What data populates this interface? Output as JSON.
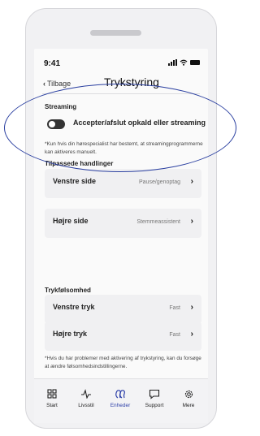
{
  "status": {
    "time": "9:41"
  },
  "nav": {
    "back_label": "Tilbage",
    "title": "Trykstyring"
  },
  "streaming": {
    "heading": "Streaming",
    "toggle_label": "Accepter/afslut opkald eller streaming",
    "toggle_on": false,
    "note": "*Kun hvis din hørespecialist har bestemt, at streamingprogrammerne kan aktiveres manuelt."
  },
  "actions": {
    "heading": "Tilpassede handlinger",
    "items": [
      {
        "label": "Venstre side",
        "value": "Pause/genoptag"
      },
      {
        "label": "Højre side",
        "value": "Stemmeassistent"
      }
    ]
  },
  "sensitivity": {
    "heading": "Trykfølsomhed",
    "items": [
      {
        "label": "Venstre tryk",
        "value": "Fast"
      },
      {
        "label": "Højre tryk",
        "value": "Fast"
      }
    ],
    "note": "*Hvis du har problemer med aktivering af trykstyring, kan du forsøge at ændre følsomhedsindstillingerne."
  },
  "tabs": [
    {
      "label": "Start",
      "icon": "grid-icon"
    },
    {
      "label": "Livsstil",
      "icon": "pulse-icon"
    },
    {
      "label": "Enheder",
      "icon": "hearing-aids-icon",
      "active": true
    },
    {
      "label": "Support",
      "icon": "chat-icon"
    },
    {
      "label": "Mere",
      "icon": "gear-icon"
    }
  ],
  "colors": {
    "accent": "#2c3fa8",
    "annotation": "#2a3fa0"
  }
}
